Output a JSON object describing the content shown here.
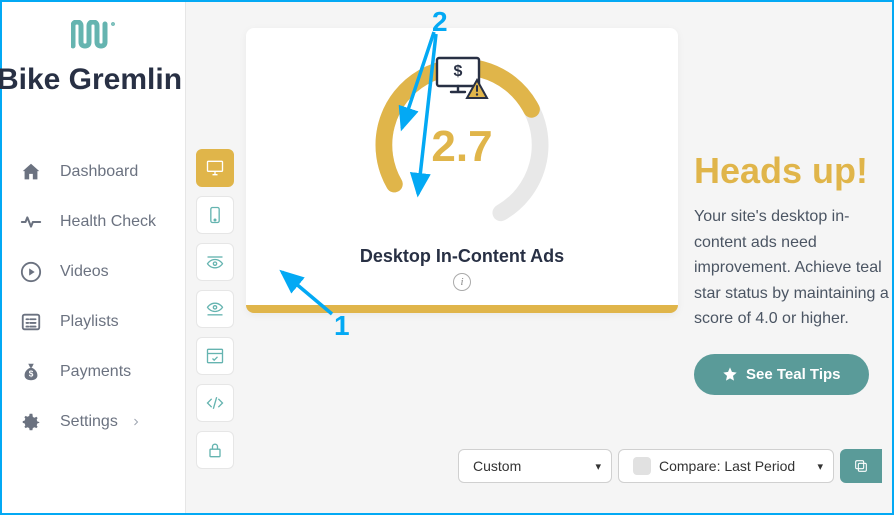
{
  "site_title": "Bike Gremlin",
  "nav": {
    "dashboard": "Dashboard",
    "health": "Health Check",
    "videos": "Videos",
    "playlists": "Playlists",
    "payments": "Payments",
    "settings": "Settings"
  },
  "card": {
    "score": "2.7",
    "title": "Desktop In-Content Ads"
  },
  "copy": {
    "heading": "Heads up!",
    "body": "Your site's desktop in-content ads need improvement. Achieve teal star status by maintaining a score of 4.0 or higher.",
    "button": "See Teal Tips"
  },
  "filters": {
    "range": "Custom",
    "compare": "Compare: Last Period"
  },
  "annotations": {
    "one": "1",
    "two": "2"
  },
  "colors": {
    "accent": "#e0b54a",
    "teal": "#5a9b99"
  }
}
